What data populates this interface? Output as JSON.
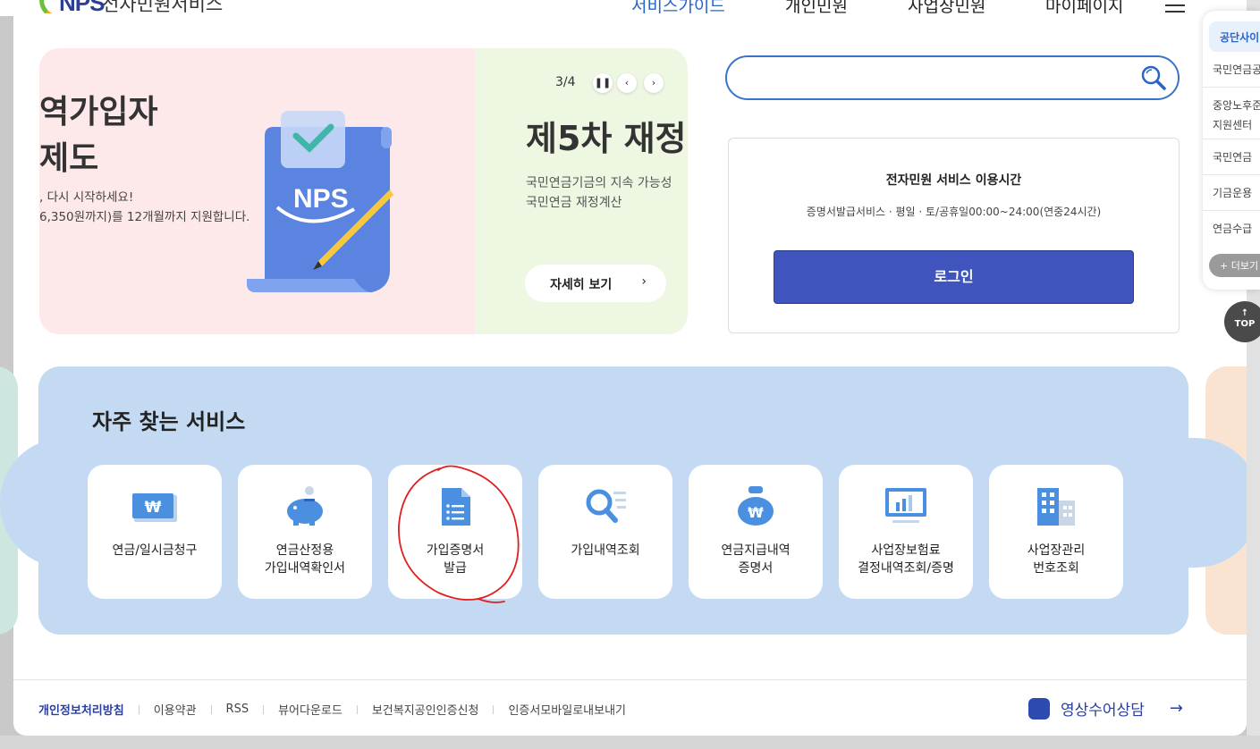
{
  "header": {
    "logo_mark": "NPS",
    "logo_text": "전자민원서비스",
    "nav": [
      "서비스가이드",
      "개인민원",
      "사업장민원",
      "마이페이지"
    ]
  },
  "quick_menu": {
    "head": "공단사이",
    "items": [
      "국민연금공",
      "중앙노후준\n지원센터",
      "국민연금",
      "기금운용",
      "연금수급"
    ],
    "more": "+ 더보기",
    "top": "TOP"
  },
  "banner": {
    "slide1": {
      "title": "역가입자\n제도",
      "desc": ", 다시 시작하세요!\n6,350원까지)를 12개월까지 지원합니다."
    },
    "counter": "3/4",
    "pause_icon": "pause-icon",
    "prev_icon": "chevron-left-icon",
    "next_icon": "chevron-right-icon",
    "slide2": {
      "title": "제5차 재정",
      "desc": "국민연금기금의 지속 가능성\n국민연금 재정계산",
      "more": "자세히 보기"
    }
  },
  "search": {
    "placeholder": "",
    "icon": "search-icon"
  },
  "service_time": {
    "title": "전자민원 서비스 이용시간",
    "desc": "증명서발급서비스 · 평일 · 토/공휴일00:00~24:00(연중24시간)",
    "login": "로그인"
  },
  "frequent": {
    "title": "자주 찾는 서비스",
    "cards": [
      {
        "label": "연금/일시금청구",
        "icon": "won-card-icon"
      },
      {
        "label": "연금산정용\n가입내역확인서",
        "icon": "piggy-bank-icon"
      },
      {
        "label": "가입증명서\n발급",
        "icon": "document-icon"
      },
      {
        "label": "가입내역조회",
        "icon": "search-list-icon"
      },
      {
        "label": "연금지급내역\n증명서",
        "icon": "money-bag-icon"
      },
      {
        "label": "사업장보험료\n결정내역조회/증명",
        "icon": "monitor-chart-icon"
      },
      {
        "label": "사업장관리\n번호조회",
        "icon": "building-icon"
      }
    ]
  },
  "footer": {
    "links": [
      "개인정보처리방침",
      "이용약관",
      "RSS",
      "뷰어다운로드",
      "보건복지공인인증신청",
      "인증서모바일로내보내기"
    ],
    "sign_language": "영상수어상담"
  },
  "colors": {
    "brand_blue": "#3f55bd",
    "accent": "#3874c8",
    "annotation_red": "#e02020"
  }
}
